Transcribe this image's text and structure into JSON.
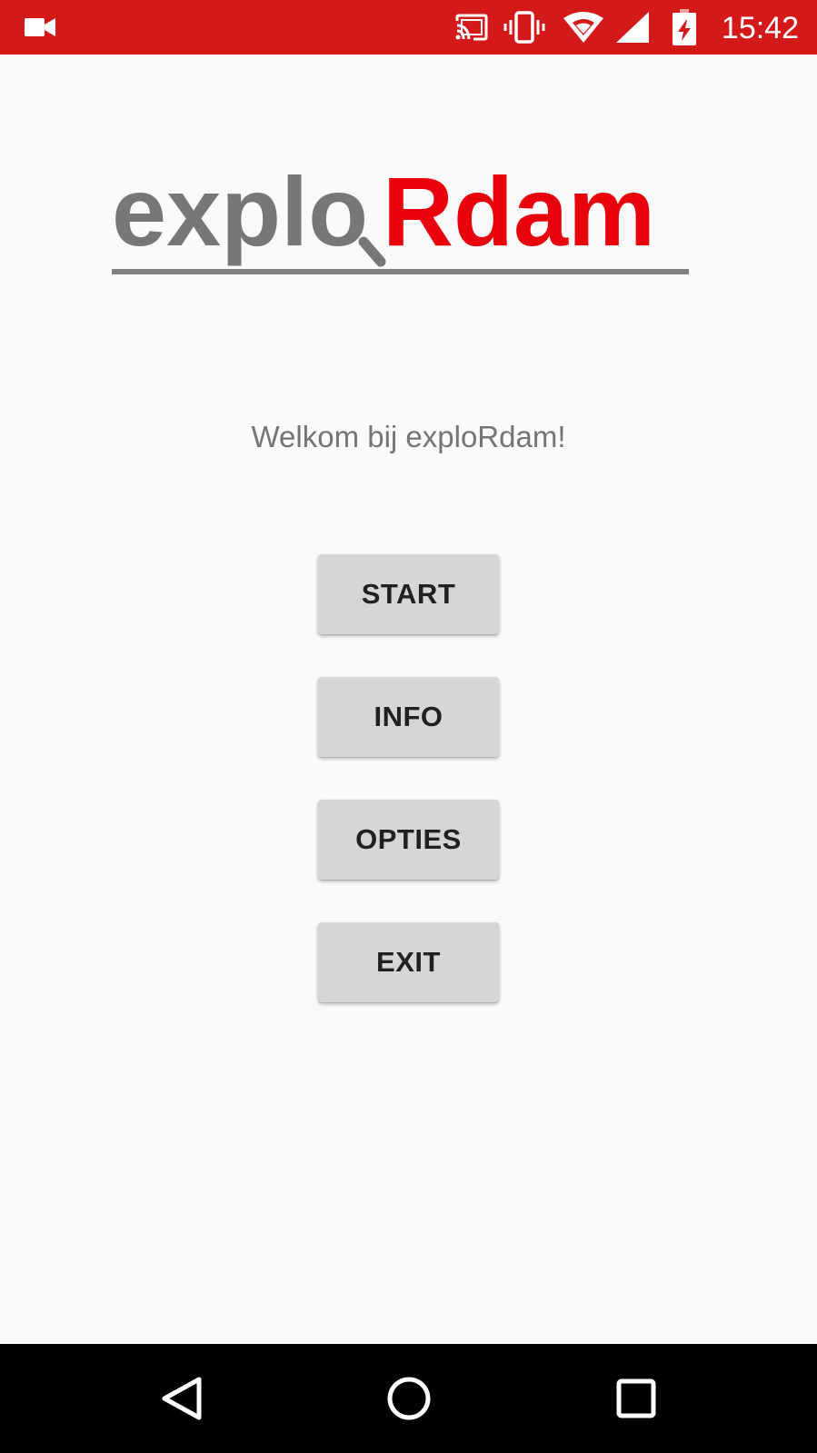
{
  "status_bar": {
    "time": "15:42",
    "background_color": "#d31919",
    "icons": [
      "videocam-icon",
      "cast-icon",
      "vibrate-icon",
      "wifi-icon",
      "signal-icon",
      "battery-charging-icon"
    ]
  },
  "logo": {
    "part1": "explo",
    "part2": "Rdam",
    "part1_color": "#777777",
    "part2_color": "#e8000b",
    "underline_color": "#808080"
  },
  "welcome_text": "Welkom bij exploRdam!",
  "menu": {
    "start": "START",
    "info": "INFO",
    "options": "OPTIES",
    "exit": "EXIT"
  },
  "nav_bar": {
    "icons": [
      "back-icon",
      "home-icon",
      "recents-icon"
    ]
  }
}
